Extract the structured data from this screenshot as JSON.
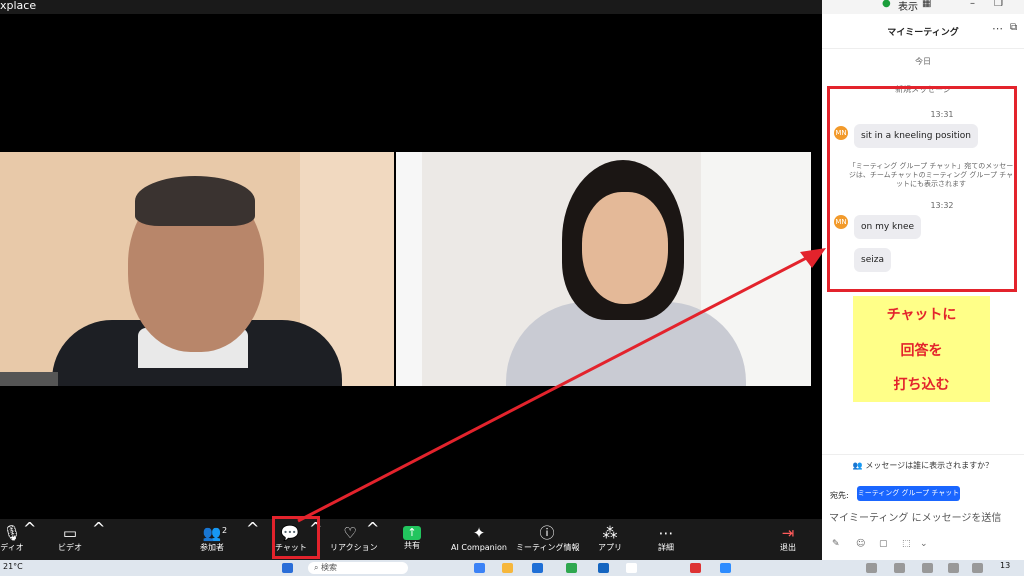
{
  "window": {
    "title": "xplace"
  },
  "topright": {
    "view_label": "表示"
  },
  "chat": {
    "title": "マイミーティング",
    "date_label": "今日",
    "new_message_label": "新規メッセージ",
    "messages": [
      {
        "time": "13:31",
        "avatar": "MN",
        "text": "sit in a kneeling position"
      },
      {
        "time": "13:32",
        "avatar": "MN",
        "text": "on my knee"
      },
      {
        "text": "seiza"
      }
    ],
    "notice": "「ミーティング グループ チャット」宛てのメッセージは、チームチャットのミーティング グループ チャットにも表示されます",
    "visibility_label": "メッセージは誰に表示されますか？",
    "to_label": "宛先:",
    "to_value": "ミーティング グループ チャット",
    "input_placeholder": "マイミーティング にメッセージを送信"
  },
  "annotation": {
    "lines": [
      "チャットに",
      "回答を",
      "打ち込む"
    ],
    "color": "#e3232c",
    "background": "#ffff88"
  },
  "toolbar": {
    "audio_label": "ディオ",
    "video_label": "ビデオ",
    "participants_label": "参加者",
    "participants_count": "2",
    "chat_label": "チャット",
    "reactions_label": "リアクション",
    "share_label": "共有",
    "ai_label": "AI Companion",
    "info_label": "ミーティング情報",
    "apps_label": "アプリ",
    "more_label": "詳細",
    "leave_label": "退出"
  },
  "taskbar": {
    "temperature": "21°C",
    "search_placeholder": "検索",
    "time_fragment": "13"
  },
  "colors": {
    "accent": "#1a66ff",
    "share_green": "#22c55e",
    "highlight_red": "#e3232c"
  }
}
